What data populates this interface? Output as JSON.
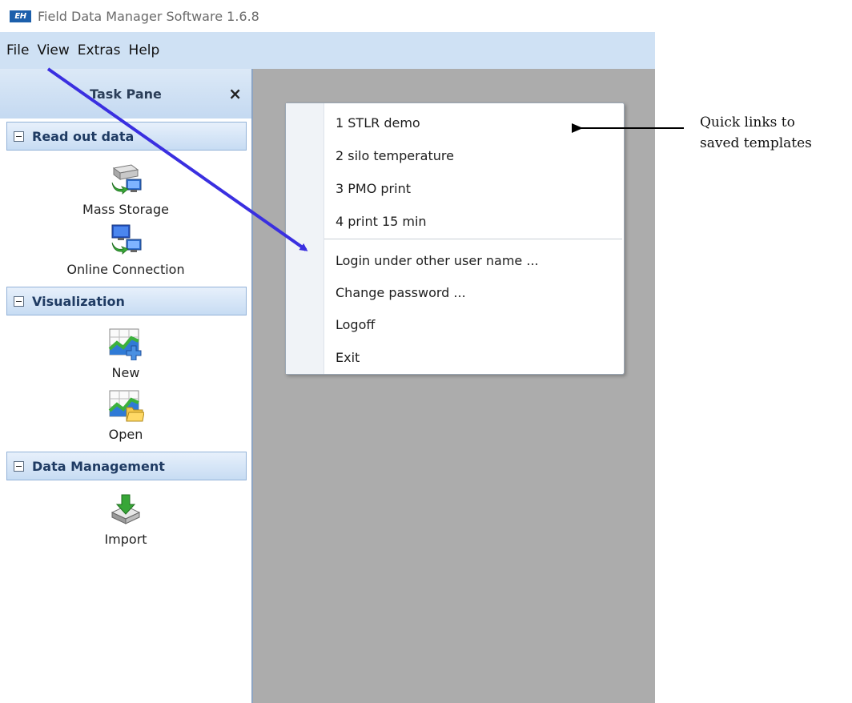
{
  "window": {
    "logo_text": "EH",
    "title": "Field Data Manager Software 1.6.8"
  },
  "menubar": {
    "items": [
      "File",
      "View",
      "Extras",
      "Help"
    ]
  },
  "task_pane": {
    "title": "Task Pane",
    "close_symbol": "×",
    "sections": [
      {
        "label": "Read out data",
        "items": [
          {
            "label": "Mass Storage",
            "icon": "mass-storage-icon"
          },
          {
            "label": "Online Connection",
            "icon": "online-connection-icon"
          }
        ]
      },
      {
        "label": "Visualization",
        "items": [
          {
            "label": "New",
            "icon": "new-visualization-icon"
          },
          {
            "label": "Open",
            "icon": "open-visualization-icon"
          }
        ]
      },
      {
        "label": "Data Management",
        "items": [
          {
            "label": "Import",
            "icon": "import-icon"
          }
        ]
      }
    ]
  },
  "file_menu": {
    "items": [
      "1 STLR demo",
      "2 silo temperature",
      "3 PMO print",
      "4 print 15 min",
      "Login under other user name ...",
      "Change password ...",
      "Logoff",
      "Exit"
    ]
  },
  "annotation": {
    "line1": "Quick links to",
    "line2": "saved templates"
  },
  "colors": {
    "menubar_bg": "#cfe1f4",
    "main_area_bg": "#acacac",
    "section_text": "#1f3b63",
    "pointer_arrow": "#3a2fe0"
  }
}
